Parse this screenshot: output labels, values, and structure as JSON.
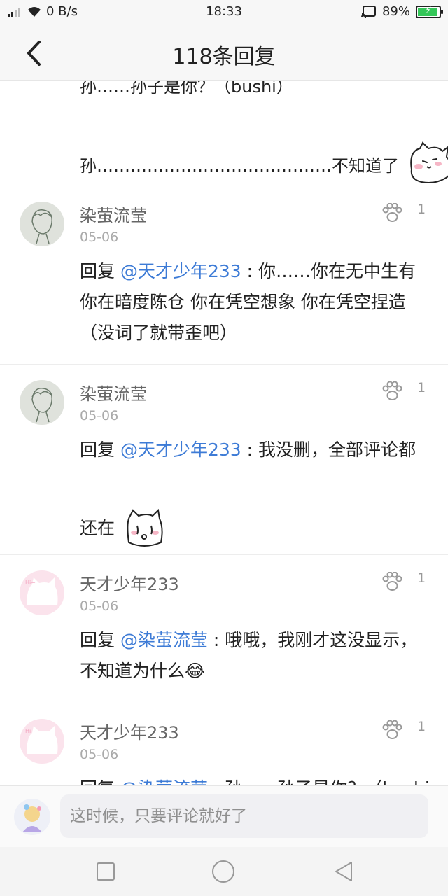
{
  "status_bar": {
    "network_speed": "0 B/s",
    "time": "18:33",
    "battery_percent": "89%",
    "battery_level": 0.89
  },
  "header": {
    "title": "118条回复"
  },
  "partial_comment": {
    "line1": "孙……孙子是你？（bushi）",
    "line2": "孙……………………………………不知道了"
  },
  "comments": [
    {
      "user": "染萤流莹",
      "date": "05-06",
      "likes": "1",
      "reply_prefix": "回复 ",
      "mention": "@天才少年233",
      "text_a": " : 你……你在无中生有你在暗度陈仓 你在凭空想象 你在凭空捏造（没词了就带歪吧）"
    },
    {
      "user": "染萤流莹",
      "date": "05-06",
      "likes": "1",
      "reply_prefix": "回复 ",
      "mention": "@天才少年233",
      "text_a": " : 我没删，全部评论都",
      "text_b": "还在"
    },
    {
      "user": "天才少年233",
      "date": "05-06",
      "likes": "1",
      "reply_prefix": "回复 ",
      "mention": "@染萤流莹",
      "text_a": " : 哦哦，我刚才这没显示，不知道为什么",
      "emoji": "😂"
    },
    {
      "user": "天才少年233",
      "date": "05-06",
      "likes": "1",
      "reply_prefix": "回复 ",
      "mention": "@染萤流莹",
      "text_a": " : 孙……孙子是你？（bushi"
    }
  ],
  "input": {
    "placeholder": "这时候，只要评论就好了"
  },
  "icons": {
    "back": "chevron-left-icon",
    "like": "paw-icon",
    "nav_recent": "square-icon",
    "nav_home": "circle-icon",
    "nav_back": "triangle-back-icon"
  },
  "colors": {
    "mention": "#3d7bd6",
    "battery": "#34c759"
  }
}
